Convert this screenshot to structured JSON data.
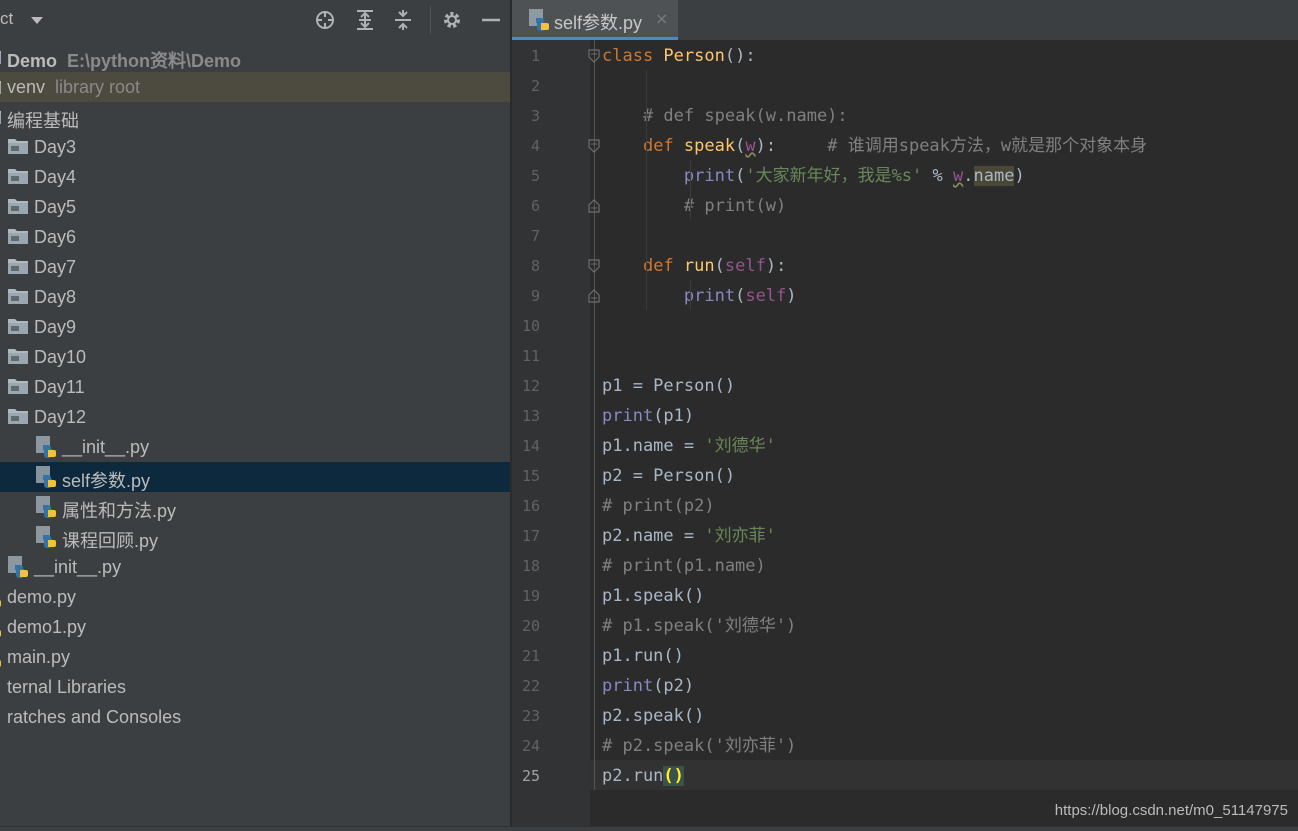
{
  "sidebar": {
    "title": "ct",
    "tree": [
      {
        "name": "Demo",
        "path": "E:\\python资料\\Demo",
        "icon": "project-folder-icon",
        "level": 0
      },
      {
        "name": "venv",
        "suffix": "library root",
        "icon": "folder-icon",
        "level": 0,
        "highlight": true
      },
      {
        "name": "编程基础",
        "icon": "folder-icon",
        "level": 0
      },
      {
        "name": "Day3",
        "icon": "folder-icon",
        "level": 1
      },
      {
        "name": "Day4",
        "icon": "folder-icon",
        "level": 1
      },
      {
        "name": "Day5",
        "icon": "folder-icon",
        "level": 1
      },
      {
        "name": "Day6",
        "icon": "folder-icon",
        "level": 1
      },
      {
        "name": "Day7",
        "icon": "folder-icon",
        "level": 1
      },
      {
        "name": "Day8",
        "icon": "folder-icon",
        "level": 1
      },
      {
        "name": "Day9",
        "icon": "folder-icon",
        "level": 1
      },
      {
        "name": "Day10",
        "icon": "folder-icon",
        "level": 1
      },
      {
        "name": "Day11",
        "icon": "folder-icon",
        "level": 1
      },
      {
        "name": "Day12",
        "icon": "folder-icon",
        "level": 1
      },
      {
        "name": "__init__.py",
        "icon": "python-file-icon",
        "level": 2
      },
      {
        "name": "self参数.py",
        "icon": "python-file-icon",
        "level": 2,
        "selected": true
      },
      {
        "name": "属性和方法.py",
        "icon": "python-file-icon",
        "level": 2
      },
      {
        "name": "课程回顾.py",
        "icon": "python-file-icon",
        "level": 2
      },
      {
        "name": "__init__.py",
        "icon": "python-file-icon",
        "level": 1
      },
      {
        "name": "demo.py",
        "icon": "python-file-icon",
        "level": 0
      },
      {
        "name": "demo1.py",
        "icon": "python-file-icon",
        "level": 0
      },
      {
        "name": "main.py",
        "icon": "python-file-icon",
        "level": 0
      },
      {
        "name": "ternal Libraries",
        "icon": "libraries-icon",
        "level": 0
      },
      {
        "name": "ratches and Consoles",
        "icon": "scratches-icon",
        "level": 0
      }
    ]
  },
  "tab": {
    "label": "self参数.py",
    "close": "×"
  },
  "editor": {
    "current_line": 25,
    "lines": [
      [
        [
          "kw",
          "class "
        ],
        [
          "fn",
          "Person"
        ],
        [
          "p",
          "():"
        ]
      ],
      [],
      [
        [
          "p",
          "    "
        ],
        [
          "cm",
          "# def speak(w.name):"
        ]
      ],
      [
        [
          "p",
          "    "
        ],
        [
          "kw",
          "def "
        ],
        [
          "fn",
          "speak"
        ],
        [
          "p",
          "("
        ],
        [
          "pm",
          "w"
        ],
        [
          "p",
          "):     "
        ],
        [
          "cm",
          "# 谁调用speak方法，w就是那个对象本身"
        ]
      ],
      [
        [
          "p",
          "        "
        ],
        [
          "bi",
          "print"
        ],
        [
          "p",
          "("
        ],
        [
          "st",
          "'大家新年好，我是%s'"
        ],
        [
          "p",
          " % "
        ],
        [
          "pm",
          "w"
        ],
        [
          "p",
          "."
        ],
        [
          "hl",
          "name"
        ],
        [
          "p",
          ")"
        ]
      ],
      [
        [
          "p",
          "        "
        ],
        [
          "cm",
          "# print(w)"
        ]
      ],
      [],
      [
        [
          "p",
          "    "
        ],
        [
          "kw",
          "def "
        ],
        [
          "fn",
          "run"
        ],
        [
          "p",
          "("
        ],
        [
          "sf",
          "self"
        ],
        [
          "p",
          "):"
        ]
      ],
      [
        [
          "p",
          "        "
        ],
        [
          "bi",
          "print"
        ],
        [
          "p",
          "("
        ],
        [
          "sf",
          "self"
        ],
        [
          "p",
          ")"
        ]
      ],
      [],
      [],
      [
        [
          "p",
          "p1 = Person()"
        ]
      ],
      [
        [
          "bi",
          "print"
        ],
        [
          "p",
          "(p1)"
        ]
      ],
      [
        [
          "p",
          "p1.name = "
        ],
        [
          "st",
          "'刘德华'"
        ]
      ],
      [
        [
          "p",
          "p2 = Person()"
        ]
      ],
      [
        [
          "cm",
          "# print(p2)"
        ]
      ],
      [
        [
          "p",
          "p2.name = "
        ],
        [
          "st",
          "'刘亦菲'"
        ]
      ],
      [
        [
          "cm",
          "# print(p1.name)"
        ]
      ],
      [
        [
          "p",
          "p1.speak()"
        ]
      ],
      [
        [
          "cm",
          "# p1.speak('刘德华')"
        ]
      ],
      [
        [
          "p",
          "p1.run()"
        ]
      ],
      [
        [
          "bi",
          "print"
        ],
        [
          "p",
          "(p2)"
        ]
      ],
      [
        [
          "p",
          "p2.speak()"
        ]
      ],
      [
        [
          "cm",
          "# p2.speak('刘亦菲')"
        ]
      ],
      [
        [
          "p",
          "p2.run"
        ],
        [
          "br",
          "()"
        ]
      ]
    ]
  },
  "watermark": "https://blog.csdn.net/m0_51147975",
  "colors": {
    "keyword": "#cc7832",
    "function": "#ffc66d",
    "comment": "#808080",
    "string": "#6a8759",
    "builtin": "#8888c6",
    "param": "#94558d",
    "self": "#94558d",
    "plain": "#a9b7c6",
    "selection": "#0d293e",
    "library_root": "#4d4a40"
  }
}
